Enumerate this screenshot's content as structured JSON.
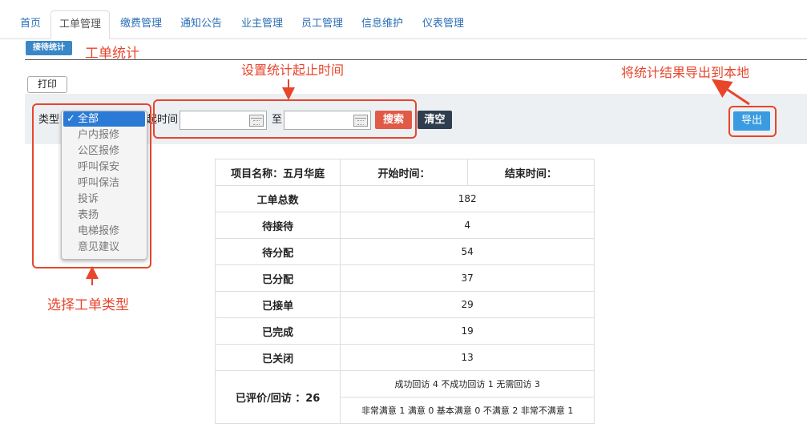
{
  "nav": {
    "tabs": [
      {
        "label": "首页"
      },
      {
        "label": "工单管理"
      },
      {
        "label": "缴费管理"
      },
      {
        "label": "通知公告"
      },
      {
        "label": "业主管理"
      },
      {
        "label": "员工管理"
      },
      {
        "label": "信息维护"
      },
      {
        "label": "仪表管理"
      }
    ]
  },
  "page": {
    "badge": "接待统计",
    "title_annotation": "工单统计"
  },
  "toolbar": {
    "print_label": "打印"
  },
  "filter": {
    "type_label": "类型",
    "time_label": "起时间",
    "to_label": "至",
    "start_value": "",
    "end_value": "",
    "search_label": "搜索",
    "clear_label": "清空",
    "export_label": "导出",
    "options": [
      "全部",
      "户内报修",
      "公区报修",
      "呼叫保安",
      "呼叫保洁",
      "投诉",
      "表扬",
      "电梯报修",
      "意见建议"
    ],
    "selected_mark": "✓"
  },
  "annotations": {
    "time_range": "设置统计起止时间",
    "export": "将统计结果导出到本地",
    "type_select": "选择工单类型"
  },
  "colors": {
    "accent": "#3a87c8",
    "annotation_red": "#e8452d",
    "search_btn": "#e05a47",
    "clear_btn": "#2f3e4e",
    "export_btn": "#3a9be0"
  },
  "stats": {
    "header": {
      "project": "项目名称：五月华庭",
      "start": "开始时间：",
      "end": "结束时间："
    },
    "rows": [
      {
        "label": "工单总数",
        "value": "182"
      },
      {
        "label": "待接待",
        "value": "4"
      },
      {
        "label": "待分配",
        "value": "54"
      },
      {
        "label": "已分配",
        "value": "37"
      },
      {
        "label": "已接单",
        "value": "29"
      },
      {
        "label": "已完成",
        "value": "19"
      },
      {
        "label": "已关闭",
        "value": "13"
      }
    ],
    "review": {
      "label": "已评价/回访 ：26",
      "line1": "成功回访 4 不成功回访 1 无需回访 3",
      "line2": "非常满意 1 满意 0 基本满意 0 不满意 2 非常不满意 1"
    }
  }
}
